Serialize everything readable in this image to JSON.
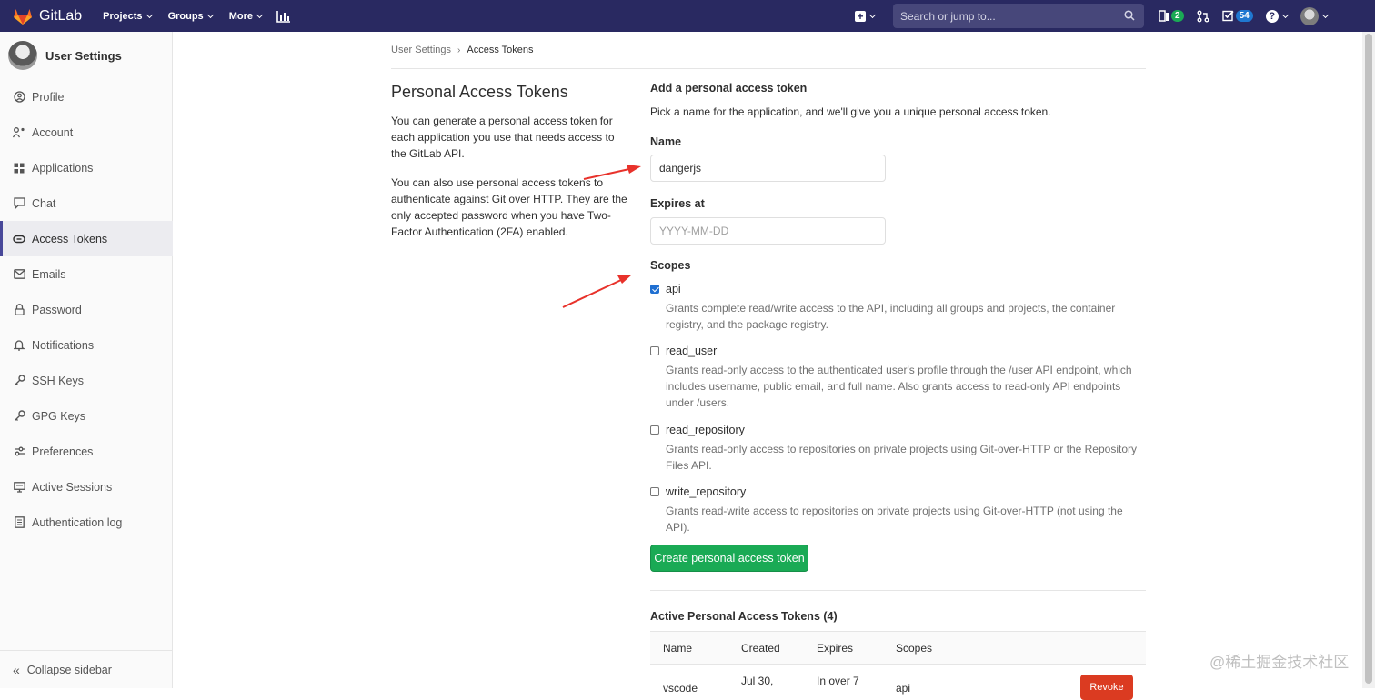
{
  "navbar": {
    "brand": "GitLab",
    "links": [
      "Projects",
      "Groups",
      "More"
    ],
    "search_placeholder": "Search or jump to...",
    "issues_count": "2",
    "todos_count": "54"
  },
  "sidebar": {
    "title": "User Settings",
    "items": [
      {
        "label": "Profile",
        "icon": "profile-icon"
      },
      {
        "label": "Account",
        "icon": "account-icon"
      },
      {
        "label": "Applications",
        "icon": "applications-icon"
      },
      {
        "label": "Chat",
        "icon": "chat-icon"
      },
      {
        "label": "Access Tokens",
        "icon": "token-icon"
      },
      {
        "label": "Emails",
        "icon": "email-icon"
      },
      {
        "label": "Password",
        "icon": "lock-icon"
      },
      {
        "label": "Notifications",
        "icon": "bell-icon"
      },
      {
        "label": "SSH Keys",
        "icon": "key-icon"
      },
      {
        "label": "GPG Keys",
        "icon": "key-icon"
      },
      {
        "label": "Preferences",
        "icon": "sliders-icon"
      },
      {
        "label": "Active Sessions",
        "icon": "monitor-icon"
      },
      {
        "label": "Authentication log",
        "icon": "log-icon"
      }
    ],
    "active": "Access Tokens",
    "collapse": "Collapse sidebar"
  },
  "breadcrumb": {
    "parent": "User Settings",
    "current": "Access Tokens"
  },
  "intro": {
    "title": "Personal Access Tokens",
    "p1": "You can generate a personal access token for each application you use that needs access to the GitLab API.",
    "p2": "You can also use personal access tokens to authenticate against Git over HTTP. They are the only accepted password when you have Two-Factor Authentication (2FA) enabled."
  },
  "form": {
    "heading": "Add a personal access token",
    "subheading": "Pick a name for the application, and we'll give you a unique personal access token.",
    "name_label": "Name",
    "name_value": "dangerjs",
    "expires_label": "Expires at",
    "expires_placeholder": "YYYY-MM-DD",
    "scopes_label": "Scopes",
    "scopes": [
      {
        "name": "api",
        "checked": true,
        "desc": "Grants complete read/write access to the API, including all groups and projects, the container registry, and the package registry."
      },
      {
        "name": "read_user",
        "checked": false,
        "desc": "Grants read-only access to the authenticated user's profile through the /user API endpoint, which includes username, public email, and full name. Also grants access to read-only API endpoints under /users."
      },
      {
        "name": "read_repository",
        "checked": false,
        "desc": "Grants read-only access to repositories on private projects using Git-over-HTTP or the Repository Files API."
      },
      {
        "name": "write_repository",
        "checked": false,
        "desc": "Grants read-write access to repositories on private projects using Git-over-HTTP (not using the API)."
      }
    ],
    "submit": "Create personal access token"
  },
  "active_tokens": {
    "title": "Active Personal Access Tokens (4)",
    "columns": [
      "Name",
      "Created",
      "Expires",
      "Scopes"
    ],
    "first_row": {
      "name": "vscode",
      "created": "Jul 30,",
      "expires": "In over 7",
      "scopes": "api",
      "action": "Revoke"
    }
  },
  "watermark": "@稀土掘金技术社区",
  "colors": {
    "navbar": "#292961",
    "success": "#1aaa55",
    "danger": "#db3b21",
    "annotation": "#e8322b"
  }
}
